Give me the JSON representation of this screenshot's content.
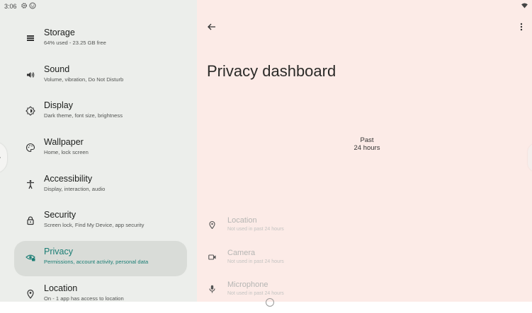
{
  "status_bar": {
    "time": "3:06",
    "icons": [
      "settings-gear-icon",
      "face-icon",
      "wifi-icon"
    ]
  },
  "sidebar": {
    "items": [
      {
        "title": "Storage",
        "subtitle": "64% used - 23.25 GB free",
        "icon": "storage-icon"
      },
      {
        "title": "Sound",
        "subtitle": "Volume, vibration, Do Not Disturb",
        "icon": "sound-icon"
      },
      {
        "title": "Display",
        "subtitle": "Dark theme, font size, brightness",
        "icon": "display-icon"
      },
      {
        "title": "Wallpaper",
        "subtitle": "Home, lock screen",
        "icon": "palette-icon"
      },
      {
        "title": "Accessibility",
        "subtitle": "Display, interaction, audio",
        "icon": "accessibility-icon"
      },
      {
        "title": "Security",
        "subtitle": "Screen lock, Find My Device, app security",
        "icon": "lock-icon"
      },
      {
        "title": "Privacy",
        "subtitle": "Permissions, account activity, personal data",
        "icon": "privacy-icon",
        "selected": true
      },
      {
        "title": "Location",
        "subtitle": "On - 1 app has access to location",
        "icon": "location-icon"
      }
    ]
  },
  "main": {
    "title": "Privacy dashboard",
    "past_line1": "Past",
    "past_line2": "24 hours",
    "permissions": [
      {
        "title": "Location",
        "subtitle": "Not used in past 24 hours",
        "icon": "location-icon"
      },
      {
        "title": "Camera",
        "subtitle": "Not used in past 24 hours",
        "icon": "camera-icon"
      },
      {
        "title": "Microphone",
        "subtitle": "Not used in past 24 hours",
        "icon": "microphone-icon"
      }
    ]
  },
  "colors": {
    "accent": "#1a7d74",
    "sidebar_bg": "#eceeeb",
    "selected_bg": "#d9dcd8",
    "main_bg": "#fcebe7"
  }
}
